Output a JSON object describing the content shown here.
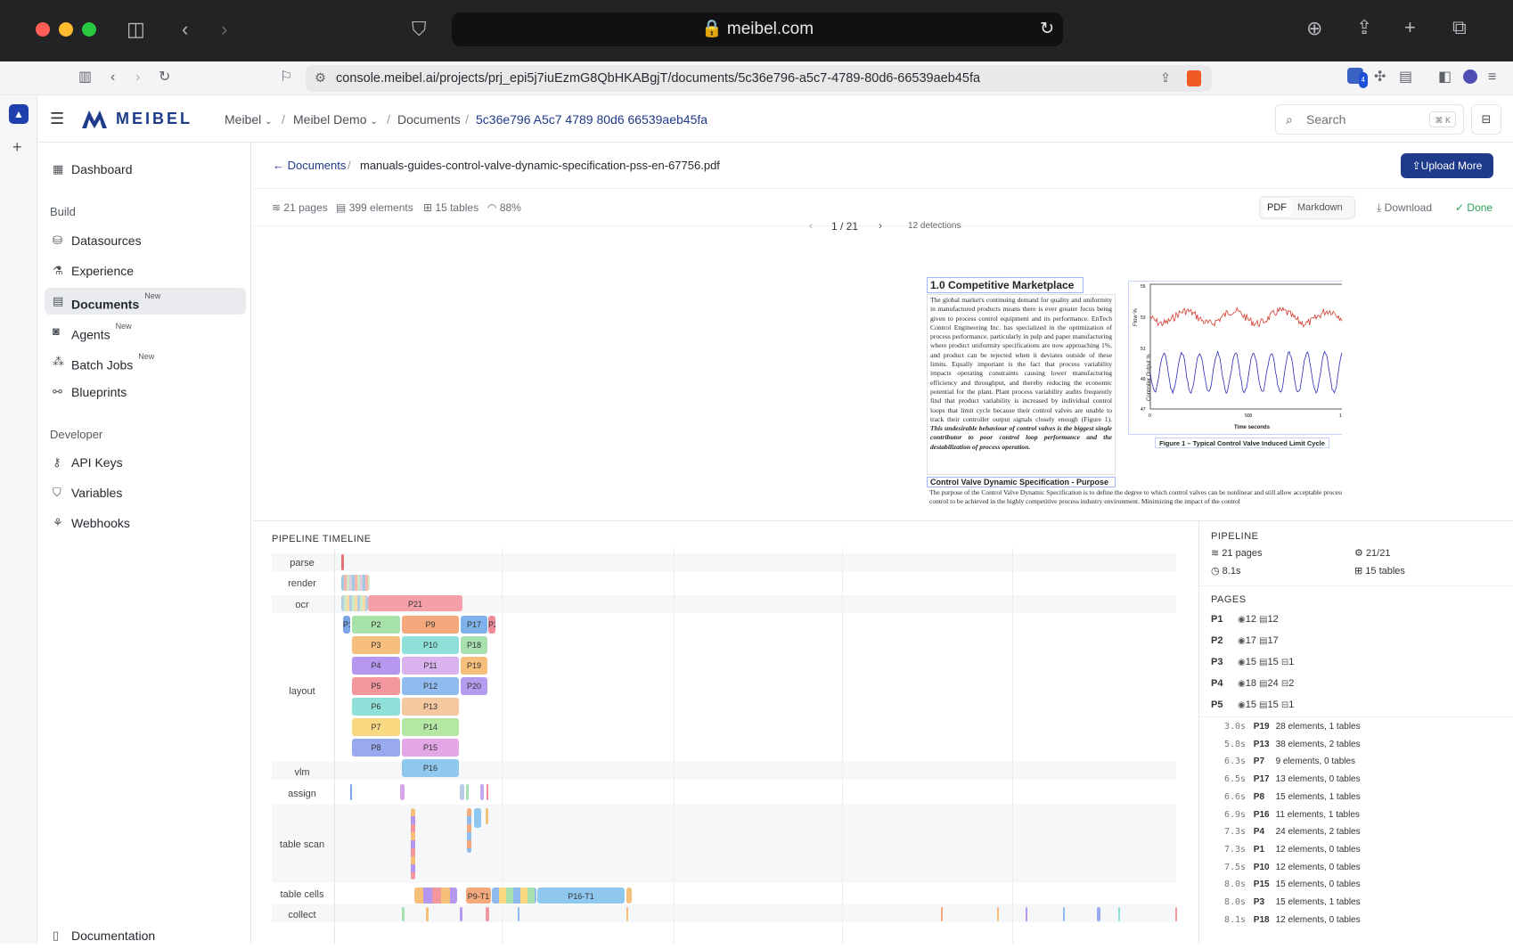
{
  "browser": {
    "address_pill": "meibel.com",
    "url": "console.meibel.ai/projects/prj_epi5j7iuEzmG8QbHKABgjT/documents/5c36e796-a5c7-4789-80d6-66539aeb45fa",
    "ext_badge": "4"
  },
  "app": {
    "brand": "MEIBEL"
  },
  "breadcrumb": {
    "org": "Meibel",
    "project": "Meibel Demo",
    "section": "Documents",
    "doc_id": "5c36e796 A5c7 4789 80d6 66539aeb45fa"
  },
  "search": {
    "placeholder": "Search",
    "shortcut": "⌘ K"
  },
  "sidebar": {
    "dashboard": "Dashboard",
    "build_heading": "Build",
    "datasources": "Datasources",
    "experience": "Experience",
    "documents": "Documents",
    "documents_badge": "New",
    "agents": "Agents",
    "agents_badge": "New",
    "batch_jobs": "Batch Jobs",
    "batch_badge": "New",
    "blueprints": "Blueprints",
    "developer_heading": "Developer",
    "api_keys": "API Keys",
    "variables": "Variables",
    "webhooks": "Webhooks",
    "documentation": "Documentation"
  },
  "doc": {
    "back": "Documents",
    "filename": "manuals-guides-control-valve-dynamic-specification-pss-en-67756.pdf",
    "upload": "Upload More",
    "pages": "21 pages",
    "elements": "399 elements",
    "tables": "15 tables",
    "confidence": "88%",
    "view_pdf": "PDF",
    "view_md": "Markdown",
    "download": "Download",
    "status": "Done",
    "pager": "1 / 21",
    "detections": "12 detections"
  },
  "pdf": {
    "heading1": "1.0 Competitive Marketplace",
    "para1": "The global market's continuing demand for quality and uniformity in manufactured products means there is ever greater focus being given to process control equipment and its performance. EnTech Control Engineering Inc. has specialized in the optimization of process performance, particularly in pulp and paper manufacturing where product uniformity specifications are now approaching 1%, and product can be rejected when it deviates outside of these limits. Equally important is the fact that process variability impacts operating constraints causing lower manufacturing efficiency and throughput, and thereby reducing the economic potential for the plant. Plant process variability audits frequently find that product variability is increased by individual control loops that limit cycle because their control valves are unable to track their controller output signals closely enough (Figure 1).",
    "para1_bold": "This undesirable behaviour of control valves is the biggest single contributor to poor control loop performance and the destabilization of process operation.",
    "caption": "Figure 1 – Typical Control Valve Induced Limit Cycle",
    "heading2": "Control Valve Dynamic Specification - Purpose",
    "para2": "The purpose of the Control Valve Dynamic Specification is to define the degree to which control valves can be nonlinear and still allow acceptable process control to be achieved in the highly competitive process industry environment. Minimizing the impact of the control",
    "chart_ylabel_top": "Flow %",
    "chart_ylabel_bot": "Controller Output %",
    "chart_xlabel": "Time seconds",
    "chart_yticks": [
      "55",
      "53",
      "51",
      "49",
      "47"
    ],
    "chart_xticks": [
      "0",
      "500",
      "1000"
    ]
  },
  "timeline": {
    "title": "PIPELINE TIMELINE",
    "lanes": [
      "parse",
      "render",
      "ocr",
      "layout",
      "vlm",
      "assign",
      "table scan",
      "table cells",
      "collect"
    ],
    "ocr_block": "P21",
    "layout_blocks": [
      "P1",
      "P2",
      "P9",
      "P17",
      "P2",
      "P3",
      "P10",
      "P18",
      "P4",
      "P11",
      "P19",
      "P5",
      "P12",
      "P20",
      "P6",
      "P13",
      "P7",
      "P14",
      "P8",
      "P15",
      "P16"
    ],
    "cells_blocks": [
      "P9-T1",
      "P16-T1"
    ]
  },
  "pipeline": {
    "title": "PIPELINE",
    "pages": "21 pages",
    "progress": "21/21",
    "time": "8.1s",
    "tables": "15 tables"
  },
  "pages_panel": {
    "title": "PAGES",
    "rows": [
      {
        "id": "P1",
        "a": "12",
        "b": "12",
        "c": ""
      },
      {
        "id": "P2",
        "a": "17",
        "b": "17",
        "c": ""
      },
      {
        "id": "P3",
        "a": "15",
        "b": "15",
        "c": "1"
      },
      {
        "id": "P4",
        "a": "18",
        "b": "24",
        "c": "2"
      },
      {
        "id": "P5",
        "a": "15",
        "b": "15",
        "c": "1"
      }
    ]
  },
  "log": [
    {
      "t": "3.0s",
      "p": "P19",
      "d": "28 elements, 1 tables"
    },
    {
      "t": "5.8s",
      "p": "P13",
      "d": "38 elements, 2 tables"
    },
    {
      "t": "6.3s",
      "p": "P7",
      "d": "9 elements, 0 tables"
    },
    {
      "t": "6.5s",
      "p": "P17",
      "d": "13 elements, 0 tables"
    },
    {
      "t": "6.6s",
      "p": "P8",
      "d": "15 elements, 1 tables"
    },
    {
      "t": "6.9s",
      "p": "P16",
      "d": "11 elements, 1 tables"
    },
    {
      "t": "7.3s",
      "p": "P4",
      "d": "24 elements, 2 tables"
    },
    {
      "t": "7.3s",
      "p": "P1",
      "d": "12 elements, 0 tables"
    },
    {
      "t": "7.5s",
      "p": "P10",
      "d": "12 elements, 0 tables"
    },
    {
      "t": "8.0s",
      "p": "P15",
      "d": "15 elements, 0 tables"
    },
    {
      "t": "8.0s",
      "p": "P3",
      "d": "15 elements, 1 tables"
    },
    {
      "t": "8.1s",
      "p": "P18",
      "d": "12 elements, 0 tables"
    }
  ],
  "colors": {
    "accent": "#1e3a8a",
    "done": "#2f9e57"
  }
}
